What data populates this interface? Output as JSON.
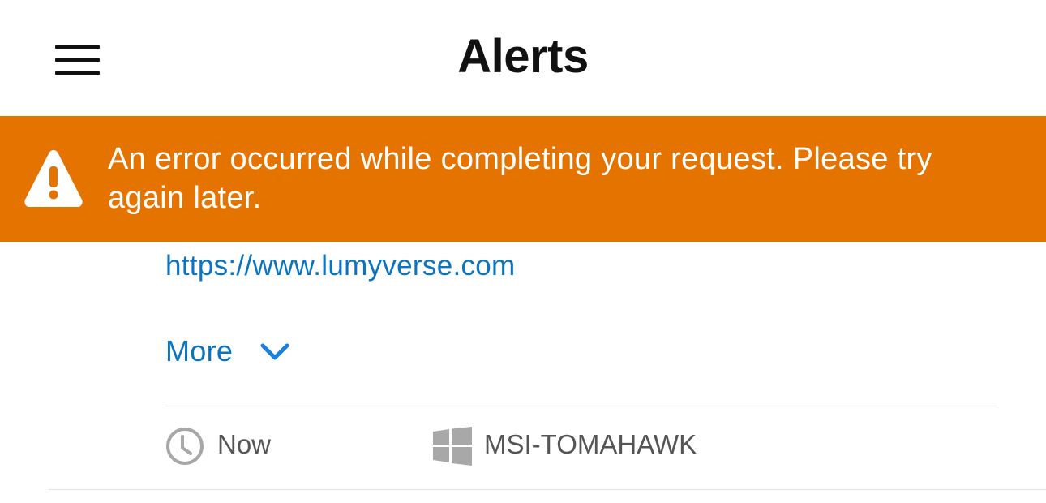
{
  "header": {
    "title": "Alerts",
    "menu_icon": "hamburger-menu-icon"
  },
  "error_banner": {
    "icon": "warning-triangle-icon",
    "message": "An error occurred while completing your request. Please try again later.",
    "background_color": "#e57300"
  },
  "alert": {
    "url": "https://www.lumyverse.com",
    "more_label": "More",
    "more_icon": "chevron-down-icon",
    "time_icon": "clock-icon",
    "time": "Now",
    "device_icon": "windows-icon",
    "device": "MSI-TOMAHAWK"
  },
  "colors": {
    "link": "#0a74c1",
    "chevron": "#1a7fe0",
    "meta_text": "#555555",
    "meta_icon": "#a8a8a8"
  }
}
